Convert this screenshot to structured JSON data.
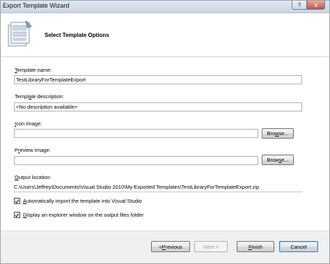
{
  "window": {
    "title": "Export Template Wizard",
    "help_label": "?",
    "close_label": "x"
  },
  "header": {
    "title": "Select Template Options"
  },
  "form": {
    "template_name": {
      "label_accel": "T",
      "label_rest": "emplate name:",
      "value": "TestLibraryForTemplateExport"
    },
    "template_description": {
      "label_pre": "Templ",
      "label_accel": "a",
      "label_rest": "te description:",
      "value": "<No description available>"
    },
    "icon_image": {
      "label_accel": "I",
      "label_rest": "con Image:",
      "value": "",
      "browse_pre": "Bro",
      "browse_accel": "w",
      "browse_rest": "se..."
    },
    "preview_image": {
      "label_pre": "P",
      "label_accel": "r",
      "label_rest": "eview Image:",
      "value": "",
      "browse_pre": "Brow",
      "browse_accel": "s",
      "browse_rest": "e..."
    },
    "output_location": {
      "label_pre": "",
      "label_accel": "O",
      "label_rest": "utput location:",
      "value": "C:\\Users\\Jeffrey\\Documents\\Visual Studio 2010\\My Exported Templates\\TestLibraryForTemplateExport.zip"
    },
    "auto_import": {
      "accel": "A",
      "rest": "utomatically import the template into Visual Studio",
      "checked": true
    },
    "open_explorer": {
      "accel": "D",
      "rest": "isplay an explorer window on the output files folder",
      "checked": true
    }
  },
  "footer": {
    "previous": {
      "prefix": "< ",
      "accel": "P",
      "rest": "revious"
    },
    "next": {
      "label": "Next >"
    },
    "finish": {
      "accel": "F",
      "rest": "inish"
    },
    "cancel": {
      "label": "Cancel"
    }
  },
  "colors": {
    "title_bar": "#c9d6e4",
    "default_button_border": "#3c7fb1",
    "close_button": "#c6503b"
  },
  "icons": [
    "wizard-template-icon",
    "checkmark-icon"
  ]
}
